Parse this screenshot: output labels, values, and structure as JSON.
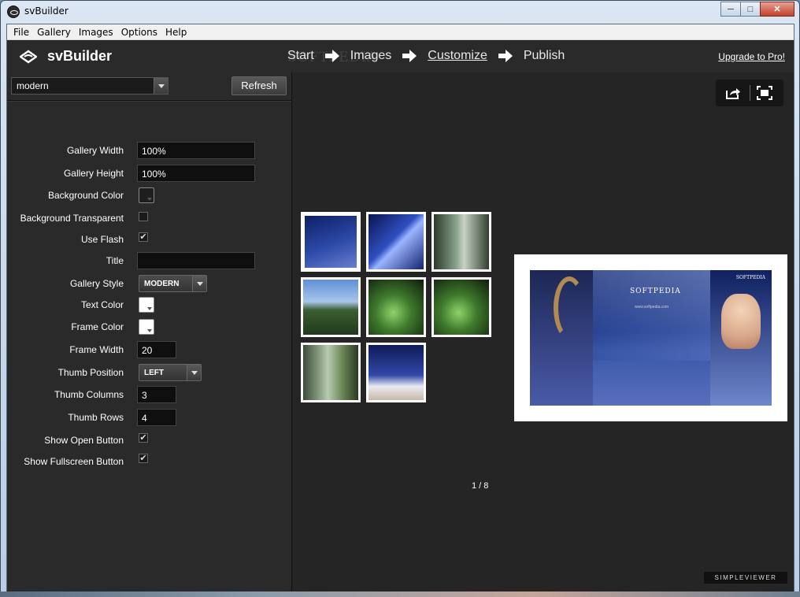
{
  "window": {
    "title": "svBuilder"
  },
  "menu": [
    "File",
    "Gallery",
    "Images",
    "Options",
    "Help"
  ],
  "header": {
    "logo": "svBuilder",
    "steps": [
      {
        "label": "Start",
        "active": false
      },
      {
        "label": "Images",
        "active": false
      },
      {
        "label": "Customize",
        "active": true
      },
      {
        "label": "Publish",
        "active": false
      }
    ],
    "watermark": "SOFTPEDIA",
    "upgrade": "Upgrade to Pro!"
  },
  "left": {
    "style_select": "modern",
    "refresh": "Refresh",
    "fields": {
      "gallery_width": {
        "label": "Gallery Width",
        "value": "100%"
      },
      "gallery_height": {
        "label": "Gallery Height",
        "value": "100%"
      },
      "background_color": {
        "label": "Background Color",
        "color": "#1e1e1e"
      },
      "background_transparent": {
        "label": "Background Transparent",
        "checked": false
      },
      "use_flash": {
        "label": "Use Flash",
        "checked": true
      },
      "title": {
        "label": "Title",
        "value": ""
      },
      "gallery_style": {
        "label": "Gallery Style",
        "value": "MODERN"
      },
      "text_color": {
        "label": "Text Color",
        "color": "#ffffff"
      },
      "frame_color": {
        "label": "Frame Color",
        "color": "#ffffff"
      },
      "frame_width": {
        "label": "Frame Width",
        "value": "20"
      },
      "thumb_position": {
        "label": "Thumb Position",
        "value": "LEFT"
      },
      "thumb_columns": {
        "label": "Thumb Columns",
        "value": "3"
      },
      "thumb_rows": {
        "label": "Thumb Rows",
        "value": "4"
      },
      "show_open_button": {
        "label": "Show Open Button",
        "checked": true
      },
      "show_fullscreen_button": {
        "label": "Show Fullscreen Button",
        "checked": true
      }
    }
  },
  "preview": {
    "counter": "1 / 8",
    "badge": "SIMPLEVIEWER",
    "main_image": {
      "logo": "SOFTPEDIA",
      "url": "www.softpedia.com"
    },
    "thumbnails": [
      {
        "theme": "blue-softpedia",
        "selected": true
      },
      {
        "theme": "blue-rays",
        "selected": false
      },
      {
        "theme": "forest",
        "selected": false
      },
      {
        "theme": "mountain",
        "selected": false
      },
      {
        "theme": "green-forest",
        "selected": false
      },
      {
        "theme": "green-forest",
        "selected": false
      },
      {
        "theme": "forest-light",
        "selected": false
      },
      {
        "theme": "blue-portrait",
        "selected": false
      }
    ]
  },
  "colors": {
    "panel": "#2a2a2a",
    "preview": "#252525",
    "accent": "#ffffff"
  }
}
